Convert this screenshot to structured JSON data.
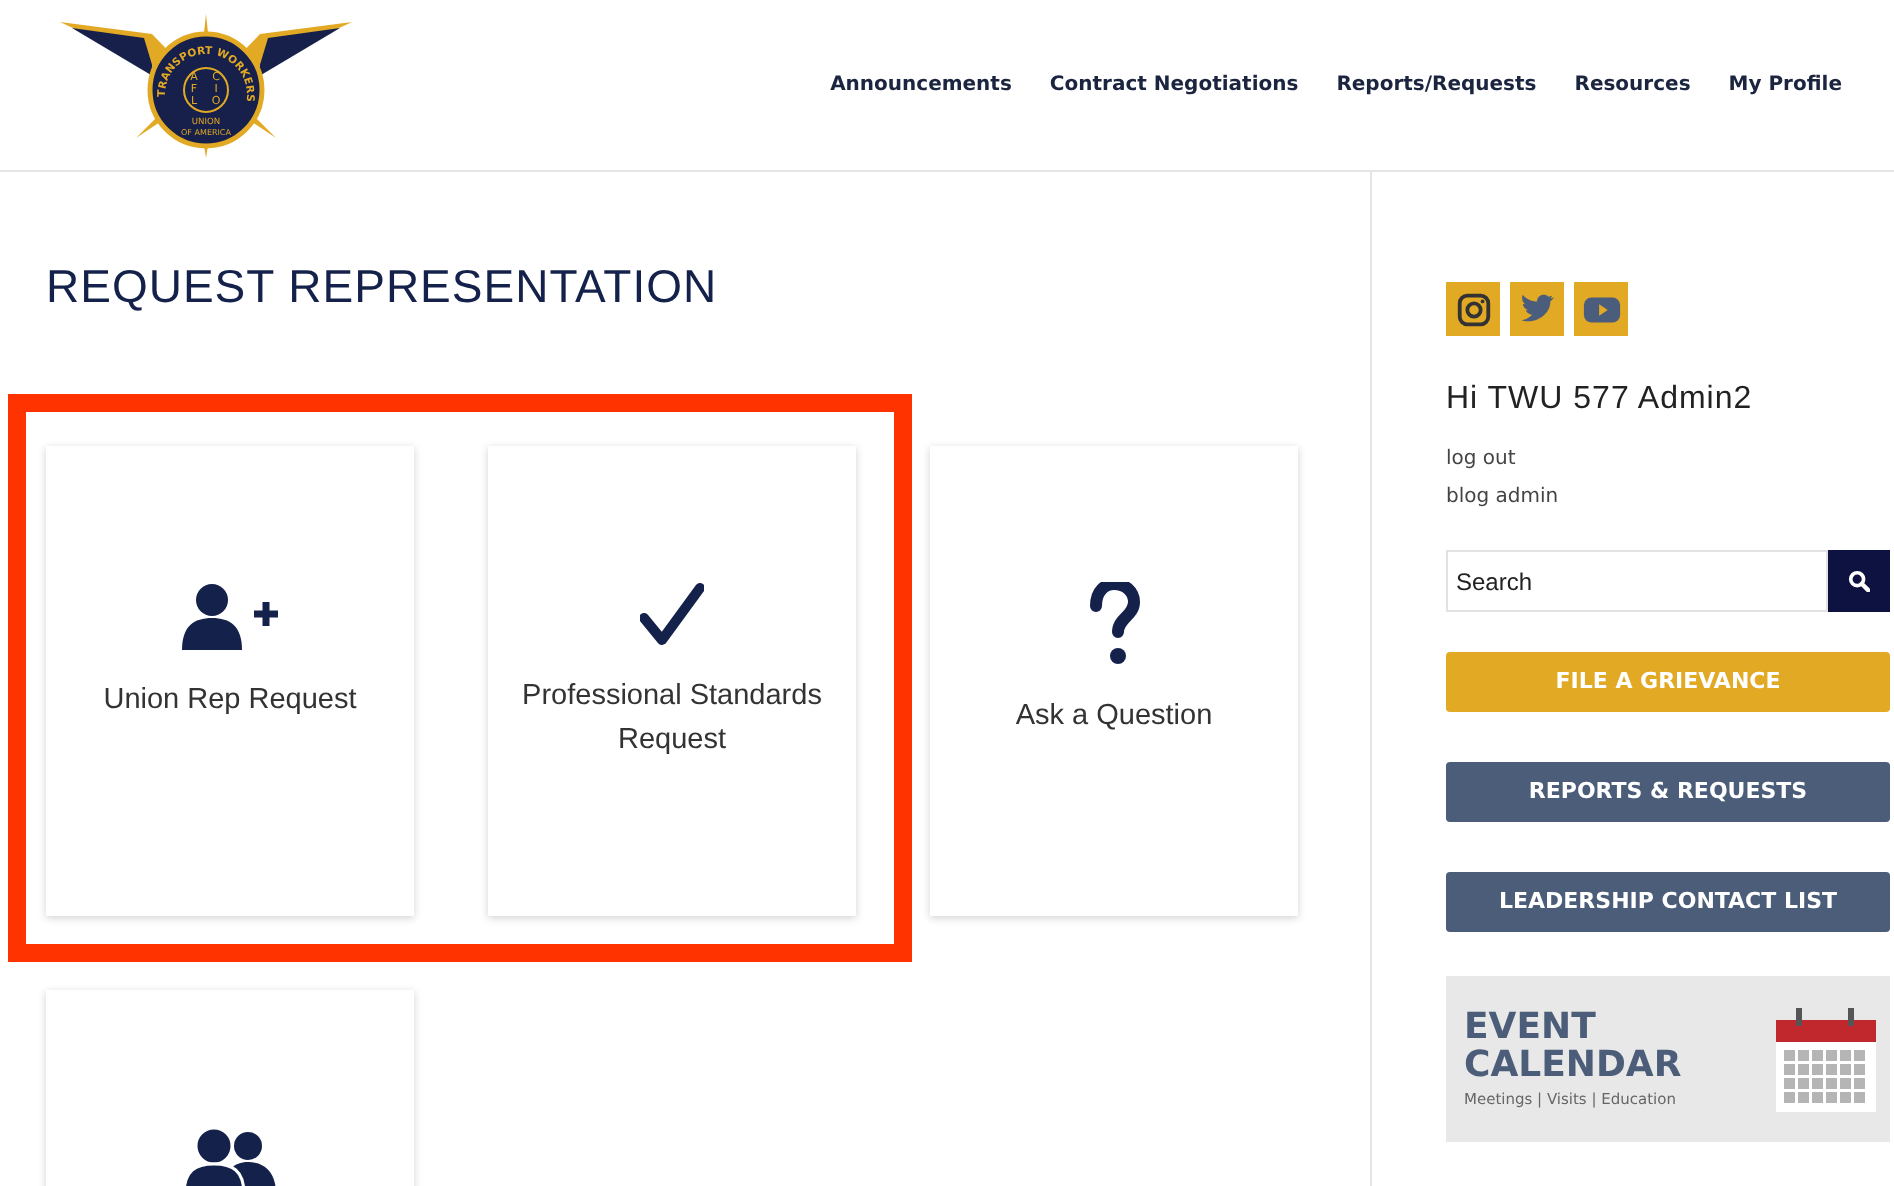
{
  "logo": {
    "texts": [
      "TRANSPORT",
      "WORKERS",
      "A",
      "C",
      "F",
      "I",
      "L",
      "O",
      "UNION",
      "OF AMERICA"
    ]
  },
  "nav": [
    {
      "label": "Announcements"
    },
    {
      "label": "Contract Negotiations"
    },
    {
      "label": "Reports/Requests"
    },
    {
      "label": "Resources"
    },
    {
      "label": "My Profile"
    }
  ],
  "page_title": "REQUEST REPRESENTATION",
  "highlight_frame": true,
  "cards": [
    {
      "kind": "user-plus",
      "label": "Union Rep Request"
    },
    {
      "kind": "check",
      "label": "Professional Standards Request"
    },
    {
      "kind": "question",
      "label": "Ask a Question"
    },
    {
      "kind": "users"
    }
  ],
  "sidebar": {
    "social": [
      {
        "kind": "instagram"
      },
      {
        "kind": "twitter"
      },
      {
        "kind": "youtube"
      }
    ],
    "greeting": "Hi TWU 577 Admin2",
    "links": [
      {
        "label": "log out"
      },
      {
        "label": "blog admin"
      }
    ],
    "search": {
      "placeholder": "Search"
    },
    "buttons": [
      {
        "label": "FILE A GRIEVANCE",
        "kind": "accent"
      },
      {
        "label": "REPORTS & REQUESTS",
        "kind": "plain"
      },
      {
        "label": "LEADERSHIP CONTACT LIST",
        "kind": "plain"
      }
    ],
    "banner": {
      "title_1": "EVENT",
      "title_2": "CALENDAR",
      "subtitle": "Meetings | Visits | Education"
    }
  }
}
